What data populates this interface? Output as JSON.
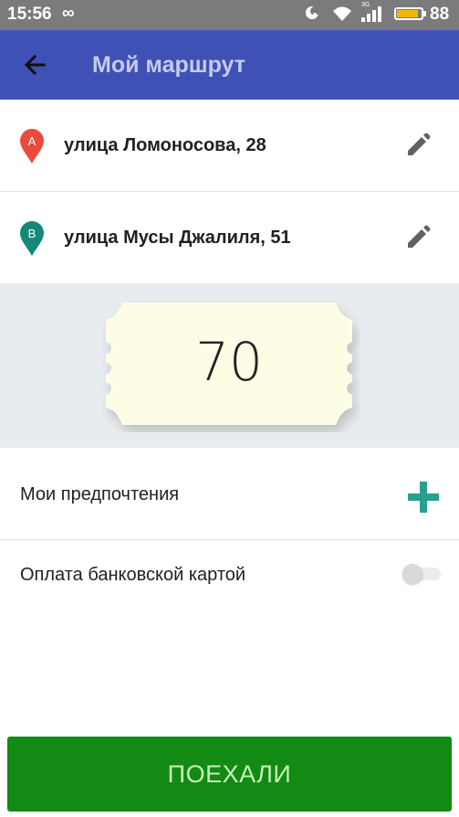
{
  "status_bar": {
    "time": "15:56",
    "loop_symbol": "∞",
    "network": "3G",
    "battery_percent": "88",
    "battery_level": 0.88,
    "icons": [
      "do-not-disturb-icon",
      "wifi-icon",
      "signal-icon",
      "battery-icon"
    ]
  },
  "app_bar": {
    "title": "Мой маршрут",
    "back_icon": "arrow-left-icon",
    "color": "#3f51b5"
  },
  "route": {
    "from": {
      "marker": "A",
      "address": "улица Ломоносова, 28",
      "color": "#e74c3c"
    },
    "to": {
      "marker": "B",
      "address": "улица Мусы Джалиля, 51",
      "color": "#14897a"
    }
  },
  "price": {
    "value": "70"
  },
  "preferences": {
    "label": "Мои предпочтения",
    "add_icon": "plus-icon",
    "accent": "#26a08f"
  },
  "card_payment": {
    "label": "Оплата банковской картой",
    "enabled": false
  },
  "go_button": {
    "label": "ПОЕХАЛИ",
    "color": "#138a13"
  }
}
